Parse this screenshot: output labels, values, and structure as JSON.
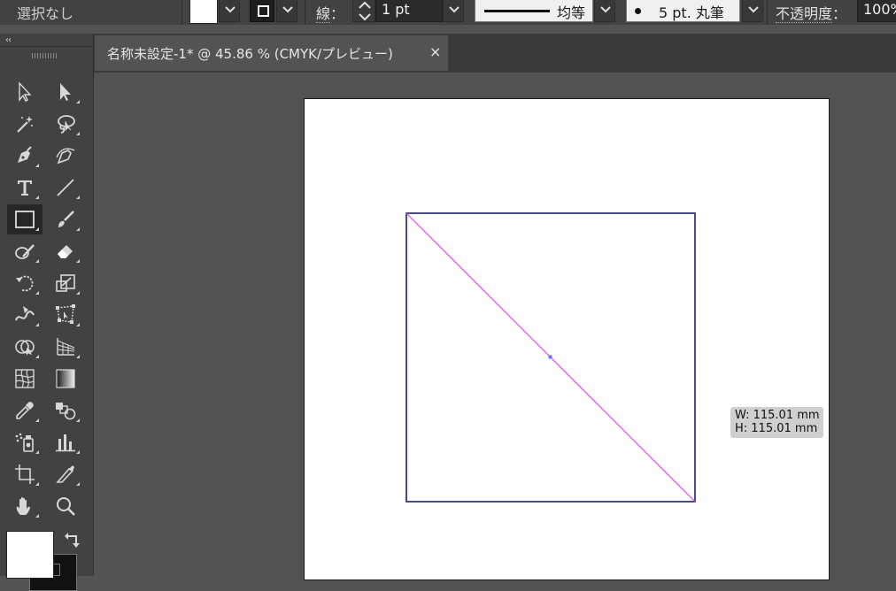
{
  "control_bar": {
    "selection_label": "選択なし",
    "fill_color": "#ffffff",
    "stroke_label": "線",
    "stroke_label_colon": "：",
    "stroke_weight": "1 pt",
    "stroke_profile": "均等",
    "brush_definition": "5 pt. 丸筆",
    "opacity_label": "不透明度",
    "opacity_label_colon": "：",
    "opacity_value": "100%"
  },
  "document_tab": {
    "title": "名称未設定-1* @ 45.86 % (CMYK/プレビュー)",
    "close_glyph": "×"
  },
  "tools_panel": {
    "collapse_glyph": "‹‹",
    "active_tool": "rectangle-tool",
    "tools": [
      "selection-tool",
      "direct-selection-tool",
      "magic-wand-tool",
      "lasso-tool",
      "pen-tool",
      "curvature-tool",
      "type-tool",
      "line-segment-tool",
      "rectangle-tool",
      "paintbrush-tool",
      "shaper-tool",
      "eraser-tool",
      "rotate-tool",
      "scale-tool",
      "warp-tool",
      "free-transform-tool",
      "shape-builder-tool",
      "perspective-grid-tool",
      "mesh-tool",
      "gradient-tool",
      "eyedropper-tool",
      "blend-tool",
      "symbol-sprayer-tool",
      "column-graph-tool",
      "artboard-tool",
      "slice-tool",
      "hand-tool",
      "zoom-tool"
    ]
  },
  "canvas": {
    "shape_stroke_color": "#1a1f66",
    "guide_color": "#e84ae8",
    "center_point_color": "#6e6ef0",
    "measure_tooltip": {
      "width": "W: 115.01 mm",
      "height": "H: 115.01 mm"
    }
  }
}
